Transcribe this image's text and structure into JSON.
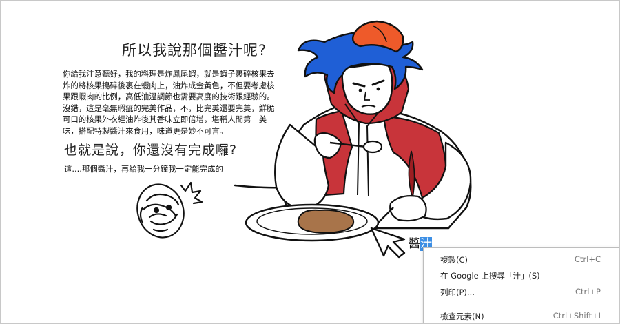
{
  "article": {
    "heading": "所以我說那個醬汁呢?",
    "paragraph": "你給我注意聽好，我的料理是炸鳳尾蝦，就是蝦子裹碎核果去炸的將核果搗碎後裹在蝦肉上，油炸成金黃色，不但要考慮核果跟蝦肉的比例，高低油溫調節也需要高度的技術跟經驗的。沒錯，這是毫無瑕疵的完美作品，不，比完美還要完美，鮮脆可口的核果外衣經油炸後其香味立即倍增，堪稱人間第一美味，搭配特製醬汁來食用，味道更是妙不可言。",
    "subheading": "也就是說，你還沒有完成囉?",
    "line": "這....那個醬汁，再給我一分鐘我一定能完成的"
  },
  "selection": {
    "text_before": "醬",
    "text_selected": "汁"
  },
  "context_menu": {
    "items": [
      {
        "label": "複製(C)",
        "shortcut": "Ctrl+C"
      },
      {
        "label": "在 Google 上搜尋「汁」(S)",
        "shortcut": ""
      },
      {
        "label": "列印(P)...",
        "shortcut": "Ctrl+P"
      },
      {
        "label": "檢查元素(N)",
        "shortcut": "Ctrl+Shift+I"
      }
    ]
  },
  "colors": {
    "hair": "#1f5fd6",
    "cap": "#ee5a2a",
    "vest": "#c8343a",
    "sauce": "#a8744a",
    "selection": "#3d8fe5"
  },
  "icons": [
    "mouse-pointer-arrow-icon"
  ]
}
